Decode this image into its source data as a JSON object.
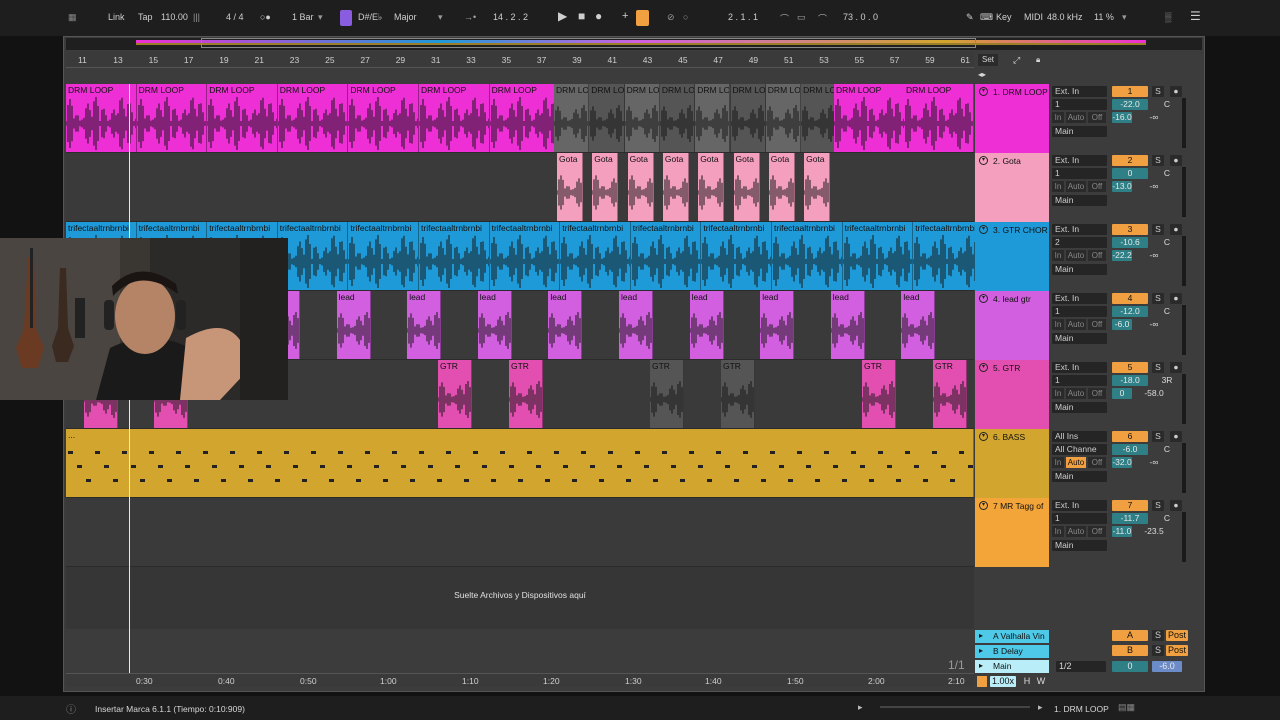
{
  "topbar": {
    "link": "Link",
    "tap": "Tap",
    "tempo": "110.00",
    "time_sig": "4 / 4",
    "quantize": "1 Bar",
    "key_root": "D#/E♭",
    "scale": "Major",
    "position": "14 .  2 .  2",
    "loop_start": "2 .  1 .  1",
    "loop_length": "73 .  0 .  0",
    "key_btn": "Key",
    "midi_btn": "MIDI",
    "sample_rate": "48.0 kHz",
    "cpu": "11 %"
  },
  "ruler": {
    "bars": [
      "11",
      "13",
      "15",
      "17",
      "19",
      "21",
      "23",
      "25",
      "27",
      "29",
      "31",
      "33",
      "35",
      "37",
      "39",
      "41",
      "43",
      "45",
      "47",
      "49",
      "51",
      "53",
      "55",
      "57",
      "59",
      "61"
    ],
    "set_label": "Set"
  },
  "time_ruler": {
    "times": [
      "0:30",
      "0:40",
      "0:50",
      "1:00",
      "1:10",
      "1:20",
      "1:30",
      "1:40",
      "1:50",
      "2:00",
      "2:10"
    ],
    "page": "1/1"
  },
  "drop_hint": "Suelte Archivos y Dispositivos aquí",
  "tracks": [
    {
      "name": "1. DRM LOOP",
      "color": "#ee2fd6",
      "input": "Ext. In",
      "ch": "1",
      "num": "1",
      "vol": "-22.0",
      "pan": "C",
      "send1": "-16.0",
      "send2": "-∞",
      "out": "Main",
      "clip_label": "DRM LOOP"
    },
    {
      "name": "2. Gota",
      "color": "#f59fbf",
      "input": "Ext. In",
      "ch": "1",
      "num": "2",
      "vol": "0",
      "pan": "C",
      "send1": "-13.0",
      "send2": "-∞",
      "out": "Main",
      "clip_label": "Gota"
    },
    {
      "name": "3. GTR CHOR",
      "color": "#1f9ad8",
      "input": "Ext. In",
      "ch": "2",
      "num": "3",
      "vol": "-10.6",
      "pan": "C",
      "send1": "-22.2",
      "send2": "-∞",
      "out": "Main",
      "clip_label": "trifectaaltrnbrnbi"
    },
    {
      "name": "4. lead gtr",
      "color": "#d25fe0",
      "input": "Ext. In",
      "ch": "1",
      "num": "4",
      "vol": "-12.0",
      "pan": "C",
      "send1": "-6.0",
      "send2": "-∞",
      "out": "Main",
      "clip_label": "lead"
    },
    {
      "name": "5. GTR",
      "color": "#e34fb0",
      "input": "Ext. In",
      "ch": "1",
      "num": "5",
      "vol": "-18.0",
      "pan": "3R",
      "send1": "0",
      "send2": "-58.0",
      "out": "Main",
      "clip_label": "GTR"
    },
    {
      "name": "6. BASS",
      "color": "#d2a62e",
      "input": "All Ins",
      "ch": "All Channe",
      "num": "6",
      "vol": "-6.0",
      "pan": "C",
      "send1": "-32.0",
      "send2": "-∞",
      "out": "Main",
      "clip_label": "..."
    },
    {
      "name": "7 MR Tagg of",
      "color": "#f3a53a",
      "input": "Ext. In",
      "ch": "1",
      "num": "7",
      "vol": "-11.7",
      "pan": "C",
      "send1": "-11.0",
      "send2": "-23.5",
      "out": "Main",
      "clip_label": ""
    }
  ],
  "io_labels": {
    "in": "In",
    "auto": "Auto",
    "off": "Off"
  },
  "returns": [
    {
      "name": "A Valhalla Vin",
      "letter": "A",
      "solo": "S",
      "post": "Post",
      "color": "#4ec9e8"
    },
    {
      "name": "B Delay",
      "letter": "B",
      "solo": "S",
      "post": "Post",
      "color": "#4ec9e8"
    }
  ],
  "master": {
    "name": "Main",
    "cue": "1/2",
    "vol": "0",
    "pan": "-6.0",
    "zoom": "1.00x",
    "h": "H",
    "w": "W"
  },
  "status": {
    "message": "Insertar Marca 6.1.1 (Tiempo: 0:10:909)",
    "selected": "1. DRM LOOP"
  }
}
